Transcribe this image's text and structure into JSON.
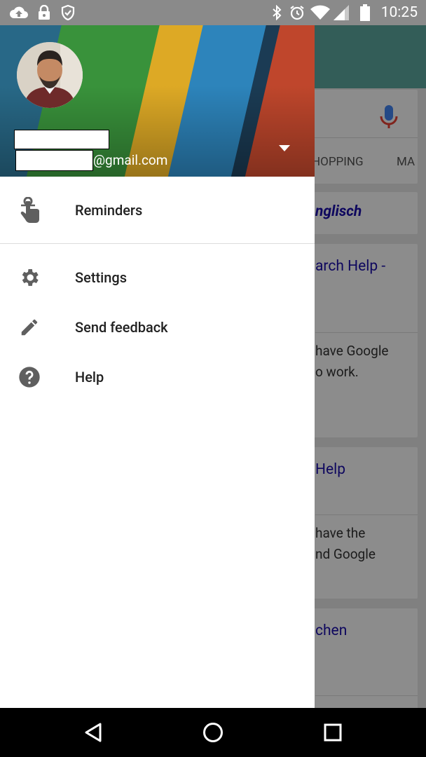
{
  "status_bar": {
    "time": "10:25",
    "left_icons": [
      "cloud-upload-icon",
      "lock-icon",
      "shield-check-icon"
    ],
    "right_icons": [
      "bluetooth-icon",
      "alarm-icon",
      "wifi-icon",
      "signal-icon",
      "battery-icon"
    ]
  },
  "background_app": {
    "tabs": [
      "HOPPING",
      "MA"
    ],
    "result_title": "nglisch",
    "cards": [
      {
        "link": "arch Help -",
        "text": [
          "have Google",
          "o work."
        ]
      },
      {
        "link": "Help",
        "text": [
          "have the",
          "nd Google"
        ]
      },
      {
        "link": "chen",
        "text": []
      }
    ]
  },
  "drawer": {
    "account": {
      "email_suffix": "@gmail.com"
    },
    "items": [
      {
        "label": "Reminders",
        "icon": "reminder-finger-icon"
      },
      {
        "label": "Settings",
        "icon": "gear-icon"
      },
      {
        "label": "Send feedback",
        "icon": "pencil-icon"
      },
      {
        "label": "Help",
        "icon": "help-circle-icon"
      }
    ]
  },
  "colors": {
    "status_bar": "#8a8a8a",
    "stripe_green": "#3c9a3e",
    "stripe_yellow": "#e9b227",
    "stripe_blue": "#2f8bc5",
    "stripe_red": "#c94a2e",
    "link": "#1a0dab"
  }
}
